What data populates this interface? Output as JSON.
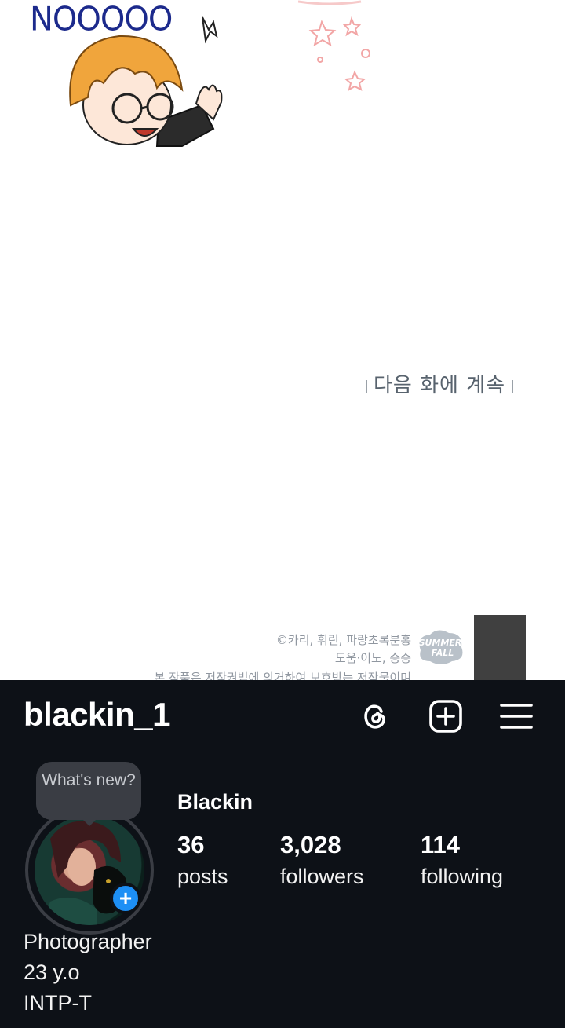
{
  "comic": {
    "shout": "NOOOOO",
    "continue_text": "다음 화에 계속",
    "credits_line1": "©카리, 휘린, 파랑초록분홍",
    "credits_line2": "도움·이노, 승승",
    "credits_line3": "본 작품은 저작권법에 의거하여 보호받는 저작물이며",
    "badge_text": "SUMMER FALL"
  },
  "profile": {
    "username": "blackin_1",
    "display_name": "Blackin",
    "note_bubble": "What's new?",
    "stats": [
      {
        "value": "36",
        "label": "posts"
      },
      {
        "value": "3,028",
        "label": "followers"
      },
      {
        "value": "114",
        "label": "following"
      }
    ],
    "bio_lines": [
      "Photographer",
      "23 y.o",
      "INTP-T"
    ],
    "icons": {
      "threads": "threads-icon",
      "new_post": "plus-square-icon",
      "menu": "hamburger-menu-icon",
      "add_story": "plus-icon"
    },
    "colors": {
      "background": "#0d1117",
      "accent_blue": "#1d8ff5"
    }
  }
}
